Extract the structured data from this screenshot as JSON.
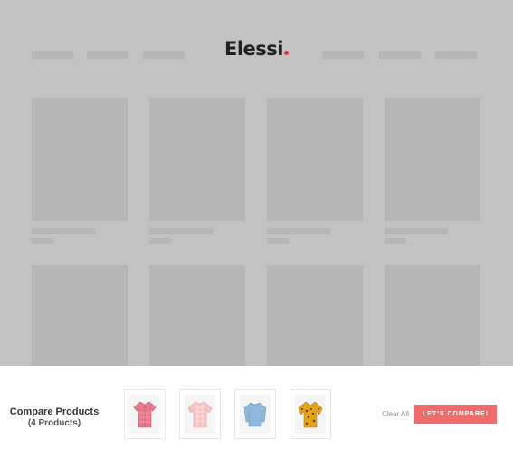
{
  "header": {
    "logo_text": "Elessi",
    "logo_dot_color": "#e03a3e"
  },
  "compare": {
    "title": "Compare Products",
    "count_label": "(4 Products)",
    "products": [
      {
        "icon": "pink-shirt-icon",
        "color": "#e8788c"
      },
      {
        "icon": "pink-sweater-icon",
        "color": "#f3b6b6"
      },
      {
        "icon": "blue-sweatshirt-icon",
        "color": "#8fb8dc"
      },
      {
        "icon": "yellow-leopard-top-icon",
        "color": "#e5a317"
      }
    ],
    "clear_label": "Clear All",
    "button_label": "LET'S COMPARE!",
    "button_color": "#ee6c6c"
  }
}
